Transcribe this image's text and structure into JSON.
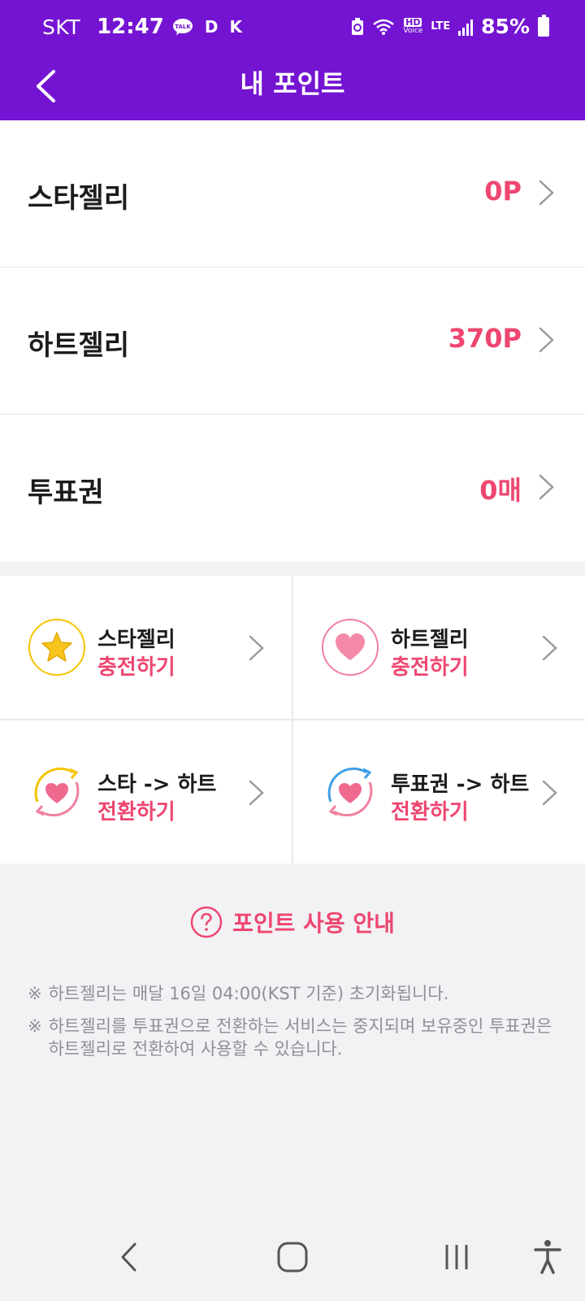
{
  "status_bar": {
    "carrier": "SKT",
    "time": "12:47",
    "talk_badge": "TALK",
    "d_badge": "D",
    "k_badge": "K",
    "hd_label": "HD",
    "voice_label": "Voice",
    "lte_label": "LTE",
    "battery": "85%"
  },
  "header": {
    "title": "내 포인트"
  },
  "points": [
    {
      "label": "스타젤리",
      "value": "0P"
    },
    {
      "label": "하트젤리",
      "value": "370P"
    },
    {
      "label": "투표권",
      "value": "0매"
    }
  ],
  "actions": [
    {
      "title": "스타젤리",
      "subtitle": "충전하기"
    },
    {
      "title": "하트젤리",
      "subtitle": "충전하기"
    },
    {
      "title": "스타 -> 하트",
      "subtitle": "전환하기"
    },
    {
      "title": "투표권 -> 하트",
      "subtitle": "전환하기"
    }
  ],
  "info": {
    "title": "포인트 사용 안내",
    "mark": "※",
    "notes": [
      "하트젤리는 매달 16일 04:00(KST 기준) 초기화됩니다.",
      "하트젤리를 투표권으로 전환하는 서비스는 중지되며 보유중인 투표권은 하트젤리로 전환하여 사용할 수 있습니다."
    ]
  },
  "colors": {
    "header": "#7414d2",
    "accent": "#ee4670",
    "star": "#f5c400",
    "heart": "#f06a8f",
    "blue": "#3ea0e6"
  }
}
